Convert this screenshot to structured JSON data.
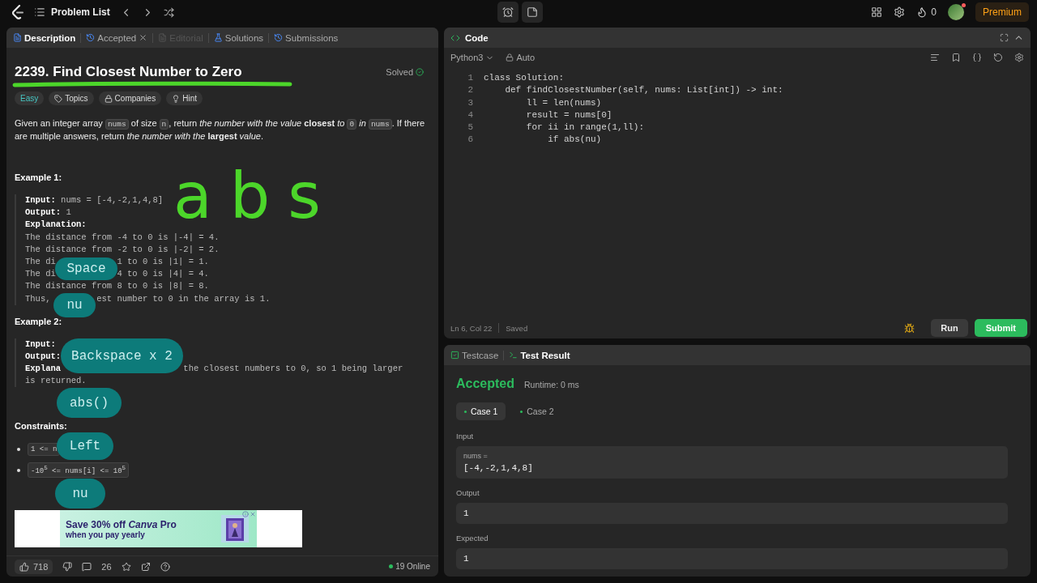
{
  "topbar": {
    "problem_list": "Problem List",
    "streak": "0",
    "premium": "Premium"
  },
  "left_tabs": [
    {
      "label": "Description",
      "selected": true,
      "disabled": false,
      "closable": false
    },
    {
      "label": "Accepted",
      "selected": false,
      "disabled": false,
      "closable": true
    },
    {
      "label": "Editorial",
      "selected": false,
      "disabled": true,
      "closable": false
    },
    {
      "label": "Solutions",
      "selected": false,
      "disabled": false,
      "closable": false
    },
    {
      "label": "Submissions",
      "selected": false,
      "disabled": false,
      "closable": false
    }
  ],
  "problem": {
    "title": "2239. Find Closest Number to Zero",
    "status": "Solved",
    "tags": [
      {
        "label": "Easy",
        "kind": "difficulty"
      },
      {
        "label": "Topics",
        "kind": "topics"
      },
      {
        "label": "Companies",
        "kind": "companies"
      },
      {
        "label": "Hint",
        "kind": "hint"
      }
    ],
    "description": [
      {
        "kind": "text",
        "text": "Given an integer array "
      },
      {
        "kind": "code",
        "text": "nums"
      },
      {
        "kind": "text",
        "text": " of size "
      },
      {
        "kind": "code",
        "text": "n"
      },
      {
        "kind": "text",
        "text": ", return *the number with the value* **closest** *to* "
      },
      {
        "kind": "code",
        "text": "0"
      },
      {
        "kind": "text",
        "text": " *in* "
      },
      {
        "kind": "code",
        "text": "nums"
      },
      {
        "kind": "text",
        "text": ". If there are multiple answers, return *the number with the* **largest** *value*."
      }
    ],
    "examples": [
      {
        "heading": "Example 1:",
        "lines": [
          [
            "**Input:** nums = [-4,-2,1,4,8]"
          ],
          [
            "**Output:** 1"
          ],
          [
            "**Explanation:**"
          ],
          [
            "The distance from -4 to 0 is |-4| = 4."
          ],
          [
            "The distance from -2 to 0 is |-2| = 2."
          ],
          [
            "The di",
            "1 to 0 is |1| = 1."
          ],
          [
            "The di",
            "4 to 0 is |4| = 4."
          ],
          [
            "The distance from 8 to 0 is |8| = 8."
          ],
          [
            "Thus,",
            "est number to 0 in the array is 1."
          ]
        ]
      },
      {
        "heading": "Example 2:",
        "lines": [
          [
            "**Input:**"
          ],
          [
            "**Output:**"
          ],
          [
            "**Explana**",
            "the closest numbers to 0, so 1 being larger"
          ],
          [
            "is returned."
          ]
        ]
      }
    ],
    "constraints_heading": "Constraints:",
    "constraints": [
      "1 <= n",
      "-10$^{5}$ <= nums[i] <= 10$^{5}$"
    ]
  },
  "annotation": {
    "handwriting": "abs"
  },
  "key_presses": [
    "Space",
    "nu",
    "Backspace x 2",
    "abs()",
    "Left",
    "nu"
  ],
  "ad": {
    "headline": "Save 30% off *Canva* Pro",
    "subline": "when you pay yearly"
  },
  "left_footer": {
    "likes": "718",
    "comments": "26",
    "online": "19 Online"
  },
  "code_panel": {
    "title": "Code",
    "language": "Python3",
    "mode": "Auto",
    "lines": [
      "class Solution:",
      "    def findClosestNumber(self, nums: List[int]) -> int:",
      "        ll = len(nums)",
      "        result = nums[0]",
      "        for ii in range(1,ll):",
      "            if abs(nu)"
    ],
    "line_numbers": [
      "1",
      "2",
      "3",
      "4",
      "5",
      "6"
    ],
    "cursor": "Ln 6, Col 22",
    "save_state": "Saved",
    "run": "Run",
    "submit": "Submit"
  },
  "test_panel": {
    "tabs": [
      {
        "label": "Testcase",
        "selected": false
      },
      {
        "label": "Test Result",
        "selected": true
      }
    ],
    "verdict": "Accepted",
    "runtime": "Runtime: 0 ms",
    "cases": [
      {
        "label": "Case 1",
        "selected": true
      },
      {
        "label": "Case 2",
        "selected": false
      }
    ],
    "input_label": "Input",
    "var_name": "nums =",
    "input_value": "[-4,-2,1,4,8]",
    "output_label": "Output",
    "output_value": "1",
    "expected_label": "Expected",
    "expected_value": "1"
  }
}
